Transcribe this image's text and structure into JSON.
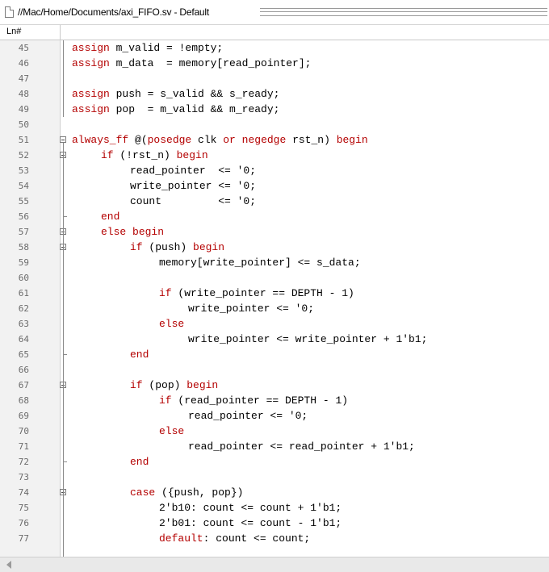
{
  "window": {
    "title": "//Mac/Home/Documents/axi_FIFO.sv - Default"
  },
  "ruler": {
    "label": "Ln#"
  },
  "colors": {
    "keyword": "#b40000",
    "text": "#000000",
    "gutter": "#f2f2f2"
  },
  "icons": {
    "document": "document-icon",
    "scroll_left": "scroll-left-arrow-icon"
  },
  "lines": [
    {
      "n": "45",
      "s": [
        [
          "kw",
          "assign"
        ],
        [
          "t",
          " m_valid = !empty;"
        ]
      ],
      "i": 1
    },
    {
      "n": "46",
      "s": [
        [
          "kw",
          "assign"
        ],
        [
          "t",
          " m_data  = memory[read_pointer];"
        ]
      ],
      "i": 1
    },
    {
      "n": "47",
      "s": [],
      "i": 1
    },
    {
      "n": "48",
      "s": [
        [
          "kw",
          "assign"
        ],
        [
          "t",
          " push = s_valid && s_ready;"
        ]
      ],
      "i": 1
    },
    {
      "n": "49",
      "s": [
        [
          "kw",
          "assign"
        ],
        [
          "t",
          " pop  = m_valid && m_ready;"
        ]
      ],
      "i": 1
    },
    {
      "n": "50",
      "s": [],
      "i": 1
    },
    {
      "n": "51",
      "s": [
        [
          "kw",
          "always_ff"
        ],
        [
          "t",
          " @("
        ],
        [
          "kw",
          "posedge"
        ],
        [
          "t",
          " clk "
        ],
        [
          "kw",
          "or"
        ],
        [
          "t",
          " "
        ],
        [
          "kw",
          "negedge"
        ],
        [
          "t",
          " rst_n) "
        ],
        [
          "kw",
          "begin"
        ]
      ],
      "i": 1
    },
    {
      "n": "52",
      "s": [
        [
          "kw",
          "if"
        ],
        [
          "t",
          " (!rst_n) "
        ],
        [
          "kw",
          "begin"
        ]
      ],
      "i": 2
    },
    {
      "n": "53",
      "s": [
        [
          "t",
          "read_pointer  <= '0;"
        ]
      ],
      "i": 3
    },
    {
      "n": "54",
      "s": [
        [
          "t",
          "write_pointer <= '0;"
        ]
      ],
      "i": 3
    },
    {
      "n": "55",
      "s": [
        [
          "t",
          "count         <= '0;"
        ]
      ],
      "i": 3
    },
    {
      "n": "56",
      "s": [
        [
          "kw",
          "end"
        ]
      ],
      "i": 2
    },
    {
      "n": "57",
      "s": [
        [
          "kw",
          "else"
        ],
        [
          "t",
          " "
        ],
        [
          "kw",
          "begin"
        ]
      ],
      "i": 2
    },
    {
      "n": "58",
      "s": [
        [
          "kw",
          "if"
        ],
        [
          "t",
          " (push) "
        ],
        [
          "kw",
          "begin"
        ]
      ],
      "i": 3
    },
    {
      "n": "59",
      "s": [
        [
          "t",
          "memory[write_pointer] <= s_data;"
        ]
      ],
      "i": 4
    },
    {
      "n": "60",
      "s": [],
      "i": 4
    },
    {
      "n": "61",
      "s": [
        [
          "kw",
          "if"
        ],
        [
          "t",
          " (write_pointer == DEPTH - 1)"
        ]
      ],
      "i": 4
    },
    {
      "n": "62",
      "s": [
        [
          "t",
          "write_pointer <= '0;"
        ]
      ],
      "i": 5
    },
    {
      "n": "63",
      "s": [
        [
          "kw",
          "else"
        ]
      ],
      "i": 4
    },
    {
      "n": "64",
      "s": [
        [
          "t",
          "write_pointer <= write_pointer + 1'b1;"
        ]
      ],
      "i": 5
    },
    {
      "n": "65",
      "s": [
        [
          "kw",
          "end"
        ]
      ],
      "i": 3
    },
    {
      "n": "66",
      "s": [],
      "i": 3
    },
    {
      "n": "67",
      "s": [
        [
          "kw",
          "if"
        ],
        [
          "t",
          " (pop) "
        ],
        [
          "kw",
          "begin"
        ]
      ],
      "i": 3
    },
    {
      "n": "68",
      "s": [
        [
          "kw",
          "if"
        ],
        [
          "t",
          " (read_pointer == DEPTH - 1)"
        ]
      ],
      "i": 4
    },
    {
      "n": "69",
      "s": [
        [
          "t",
          "read_pointer <= '0;"
        ]
      ],
      "i": 5
    },
    {
      "n": "70",
      "s": [
        [
          "kw",
          "else"
        ]
      ],
      "i": 4
    },
    {
      "n": "71",
      "s": [
        [
          "t",
          "read_pointer <= read_pointer + 1'b1;"
        ]
      ],
      "i": 5
    },
    {
      "n": "72",
      "s": [
        [
          "kw",
          "end"
        ]
      ],
      "i": 3
    },
    {
      "n": "73",
      "s": [],
      "i": 3
    },
    {
      "n": "74",
      "s": [
        [
          "kw",
          "case"
        ],
        [
          "t",
          " ({push, pop})"
        ]
      ],
      "i": 3
    },
    {
      "n": "75",
      "s": [
        [
          "t",
          "2'b10: count <= count + 1'b1;"
        ]
      ],
      "i": 4
    },
    {
      "n": "76",
      "s": [
        [
          "t",
          "2'b01: count <= count - 1'b1;"
        ]
      ],
      "i": 4
    },
    {
      "n": "77",
      "s": [
        [
          "kw",
          "default"
        ],
        [
          "t",
          ": count <= count;"
        ]
      ],
      "i": 4
    }
  ]
}
